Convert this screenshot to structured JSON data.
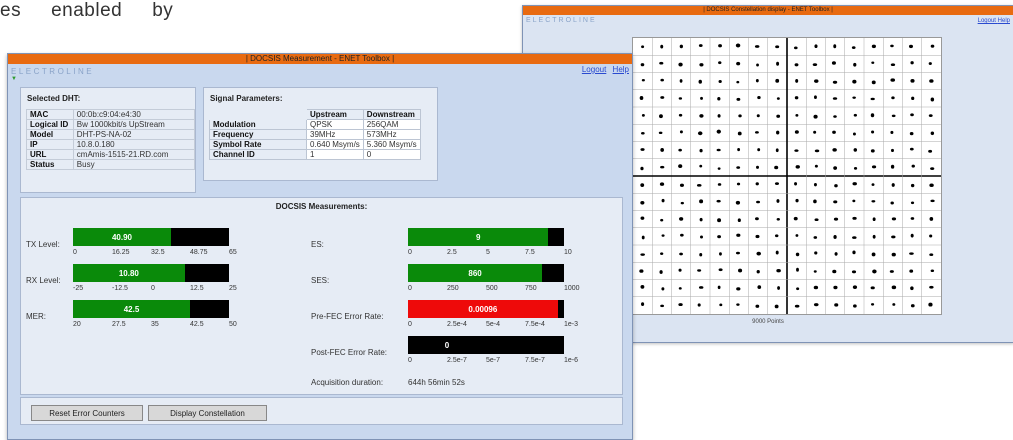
{
  "snippet": {
    "words": [
      "es",
      "enabled",
      "by"
    ]
  },
  "constellation_window": {
    "title": "| DOCSIS Constellation display - ENET Toolbox |",
    "brand": "ELECTROLINE",
    "logout": "Logout",
    "help": "Help",
    "points_label": "9000 Points",
    "grid_size": 16,
    "colors": {
      "title_bar": "#e86a10",
      "background": "#dbe4f2"
    }
  },
  "measurement_window": {
    "title": "| DOCSIS Measurement - ENET Toolbox |",
    "brand": "ELECTROLINE",
    "links": {
      "logout": "Logout",
      "help": "Help"
    },
    "selected_dht": {
      "heading": "Selected DHT:",
      "rows": [
        {
          "key": "MAC",
          "value": "00:0b:c9:04:e4:30"
        },
        {
          "key": "Logical ID",
          "value": "Bw 1000kbit/s UpStream"
        },
        {
          "key": "Model",
          "value": "DHT-PS-NA-02"
        },
        {
          "key": "IP",
          "value": "10.8.0.180"
        },
        {
          "key": "URL",
          "value": "cmAmis-1515-21.RD.com"
        },
        {
          "key": "Status",
          "value": "Busy"
        }
      ]
    },
    "signal_parameters": {
      "heading": "Signal Parameters:",
      "columns": [
        "Upstream",
        "Downstream"
      ],
      "rows": [
        {
          "key": "Modulation",
          "up": "QPSK",
          "down": "256QAM"
        },
        {
          "key": "Frequency",
          "up": "39MHz",
          "down": "573MHz"
        },
        {
          "key": "Symbol Rate",
          "up": "0.640 Msym/s",
          "down": "5.360 Msym/s"
        },
        {
          "key": "Channel ID",
          "up": "1",
          "down": "0"
        }
      ]
    },
    "measurements": {
      "heading": "DOCSIS Measurements:",
      "left": [
        {
          "label": "TX Level:",
          "value": "40.90",
          "fraction": 0.628,
          "color": "#0a8a0a",
          "ticks": [
            "0",
            "16.25",
            "32.5",
            "48.75",
            "65"
          ]
        },
        {
          "label": "RX Level:",
          "value": "10.80",
          "fraction": 0.716,
          "color": "#0a8a0a",
          "ticks": [
            "-25",
            "-12.5",
            "0",
            "12.5",
            "25"
          ]
        },
        {
          "label": "MER:",
          "value": "42.5",
          "fraction": 0.75,
          "color": "#0a8a0a",
          "ticks": [
            "20",
            "27.5",
            "35",
            "42.5",
            "50"
          ]
        }
      ],
      "right": [
        {
          "label": "ES:",
          "value": "9",
          "fraction": 0.9,
          "color": "#0a8a0a",
          "ticks": [
            "0",
            "2.5",
            "5",
            "7.5",
            "10"
          ]
        },
        {
          "label": "SES:",
          "value": "860",
          "fraction": 0.86,
          "color": "#0a8a0a",
          "ticks": [
            "0",
            "250",
            "500",
            "750",
            "1000"
          ]
        },
        {
          "label": "Pre-FEC Error Rate:",
          "value": "0.00096",
          "fraction": 0.96,
          "color": "#ee0a0a",
          "ticks": [
            "0",
            "2.5e-4",
            "5e-4",
            "7.5e-4",
            "1e-3"
          ]
        },
        {
          "label": "Post-FEC Error Rate:",
          "value": "0",
          "fraction": 0.0,
          "color": "#0a8a0a",
          "ticks": [
            "0",
            "2.5e-7",
            "5e-7",
            "7.5e-7",
            "1e-6"
          ]
        }
      ],
      "acquisition": {
        "label": "Acquisition duration:",
        "value": "644h 56min 52s"
      }
    },
    "buttons": {
      "reset": "Reset Error Counters",
      "display": "Display Constellation"
    },
    "colors": {
      "title_bar": "#e86a10",
      "background": "#c9d8ee",
      "panel": "#e6ecf5"
    }
  }
}
